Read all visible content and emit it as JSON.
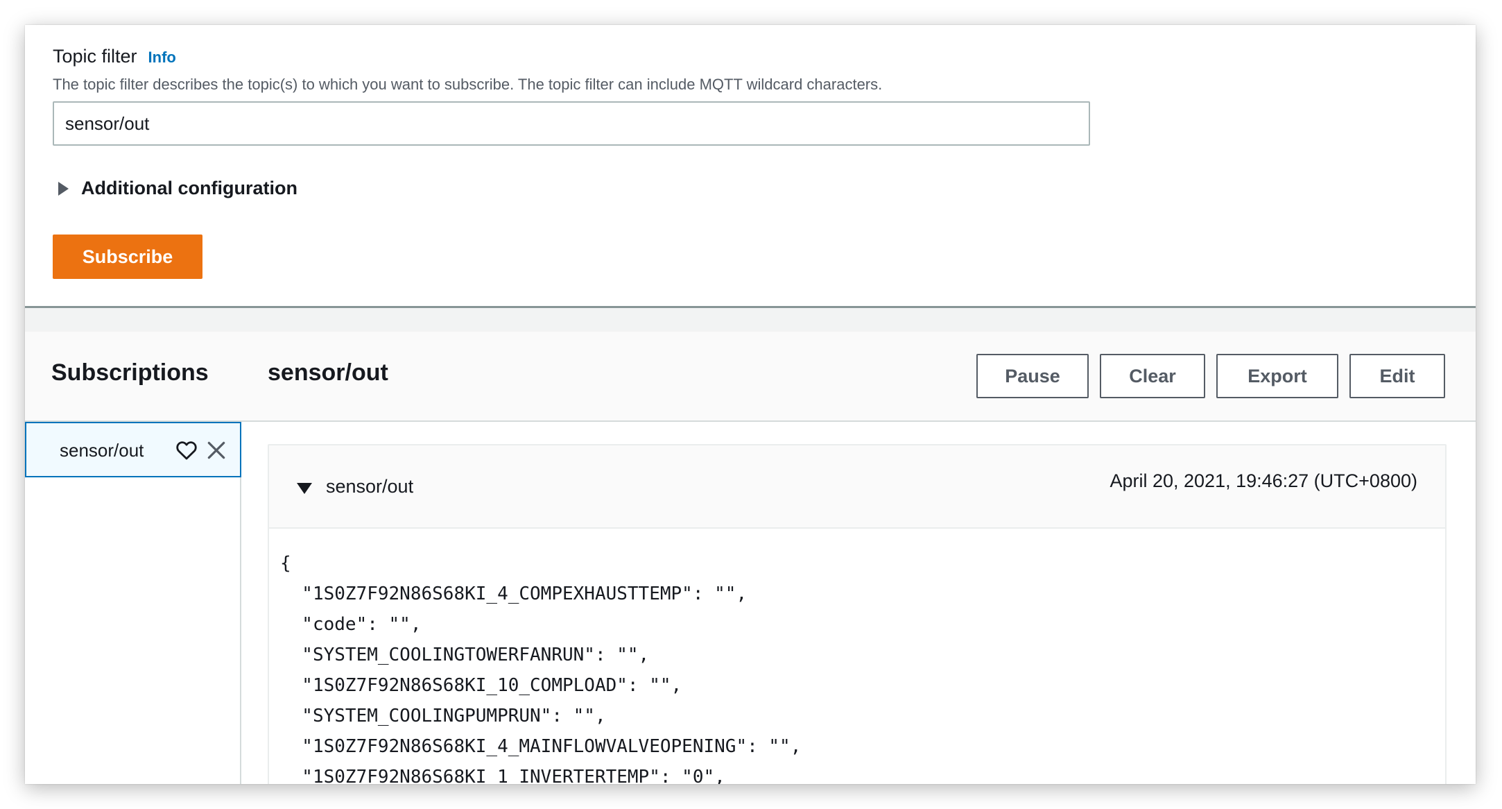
{
  "topic_filter": {
    "label": "Topic filter",
    "info_link": "Info",
    "description": "The topic filter describes the topic(s) to which you want to subscribe. The topic filter can include MQTT wildcard characters.",
    "value": "sensor/out"
  },
  "additional_configuration": {
    "label": "Additional configuration",
    "expanded": false
  },
  "subscribe_button": "Subscribe",
  "subscriptions": {
    "title": "Subscriptions",
    "items": [
      {
        "label": "sensor/out",
        "selected": true,
        "favorite_icon": "heart-icon",
        "remove_icon": "close-icon"
      }
    ]
  },
  "main": {
    "title": "sensor/out",
    "buttons": {
      "pause": "Pause",
      "clear": "Clear",
      "export": "Export",
      "edit": "Edit"
    }
  },
  "message": {
    "topic": "sensor/out",
    "timestamp": "April 20, 2021, 19:46:27 (UTC+0800)",
    "payload_lines": [
      "{",
      "  \"1S0Z7F92N86S68KI_4_COMPEXHAUSTTEMP\": \"\",",
      "  \"code\": \"\",",
      "  \"SYSTEM_COOLINGTOWERFANRUN\": \"\",",
      "  \"1S0Z7F92N86S68KI_10_COMPLOAD\": \"\",",
      "  \"SYSTEM_COOLINGPUMPRUN\": \"\",",
      "  \"1S0Z7F92N86S68KI_4_MAINFLOWVALVEOPENING\": \"\",",
      "  \"1S0Z7F92N86S68KI_1_INVERTERTEMP\": \"0\","
    ]
  },
  "colors": {
    "primary_button": "#ec7211",
    "link": "#0073bb",
    "selected_border": "#0073bb",
    "selected_background": "#f1faff",
    "text": "#16191f",
    "secondary_text": "#545b64"
  }
}
